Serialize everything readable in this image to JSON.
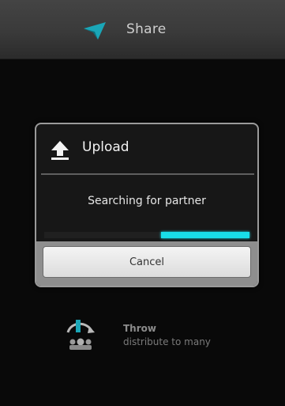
{
  "action_bar": {
    "title": "Share",
    "icon": "share-app-icon"
  },
  "dialog": {
    "title": "Upload",
    "title_icon": "upload-icon",
    "message": "Searching for partner",
    "progress": {
      "start_fraction": 0.57,
      "end_fraction": 1.0,
      "color": "#19dde8"
    },
    "cancel_label": "Cancel"
  },
  "options": [
    {
      "label": "Throw",
      "description": "distribute to many",
      "icon": "throw-icon"
    }
  ],
  "colors": {
    "accent": "#19dde8",
    "background": "#0b0b0b"
  }
}
